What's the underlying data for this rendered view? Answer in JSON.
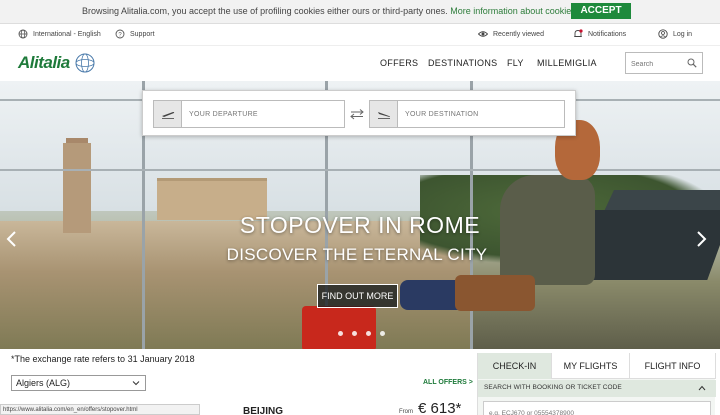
{
  "cookie_bar": {
    "text": "Browsing Alitalia.com, you accept the use of profiling cookies either ours or third-party ones.",
    "link": "More information about cookies.",
    "accept": "ACCEPT"
  },
  "util_bar": {
    "language": "International - English",
    "support": "Support",
    "recently_viewed": "Recently viewed",
    "notifications": "Notifications",
    "login": "Log in"
  },
  "header": {
    "logo": "Alitalia",
    "nav": [
      "OFFERS",
      "DESTINATIONS",
      "FLY",
      "MILLEMIGLIA"
    ],
    "search_placeholder": "Search"
  },
  "flight_search": {
    "departure_placeholder": "YOUR DEPARTURE",
    "destination_placeholder": "YOUR DESTINATION"
  },
  "hero": {
    "title": "STOPOVER IN ROME",
    "subtitle": "DISCOVER THE ETERNAL CITY",
    "button": "FIND OUT MORE",
    "slides_count": 4
  },
  "offers": {
    "exchange_note": "*The exchange rate refers to 31 January 2018",
    "selected_city": "Algiers (ALG)",
    "all_offers": "ALL OFFERS >",
    "destination": "BEIJING",
    "from": "From",
    "price": "€ 613*"
  },
  "tabs": {
    "items": [
      "CHECK-IN",
      "MY FLIGHTS",
      "FLIGHT INFO"
    ],
    "active": "CHECK-IN",
    "search_label": "SEARCH WITH BOOKING OR TICKET CODE",
    "booking_placeholder": "e.g. ECJ670 or 05554378900"
  },
  "status_bar": {
    "url": "https://www.alitalia.com/en_en/offers/stopover.html"
  },
  "colors": {
    "brand_green": "#1e7a3a",
    "accept_green": "#1e8a3c",
    "brand_red": "#c8102e"
  }
}
